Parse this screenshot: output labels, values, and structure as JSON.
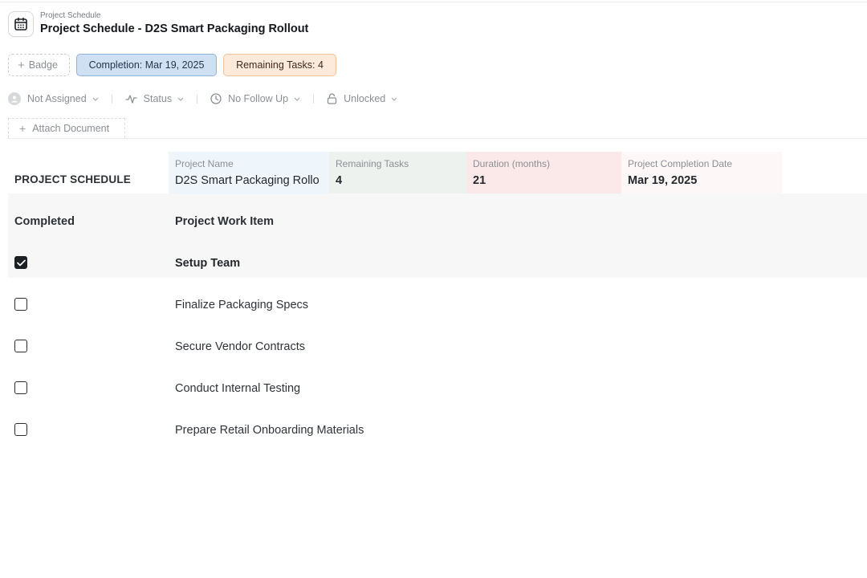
{
  "header": {
    "subtitle": "Project Schedule",
    "title": "Project Schedule - D2S Smart Packaging Rollout",
    "icon": "calendar-icon"
  },
  "badges": {
    "add_label": "Badge",
    "completion": "Completion: Mar 19, 2025",
    "remaining": "Remaining Tasks: 4"
  },
  "meta": {
    "assignee": "Not Assigned",
    "status": "Status",
    "follow_up": "No Follow Up",
    "lock": "Unlocked"
  },
  "attach_label": "Attach Document",
  "summary": {
    "label": "PROJECT SCHEDULE",
    "project_name_key": "Project Name",
    "project_name_value": "D2S Smart Packaging Rollo",
    "remaining_key": "Remaining Tasks",
    "remaining_value": "4",
    "duration_key": "Duration (months)",
    "duration_value": "21",
    "completion_key": "Project Completion Date",
    "completion_value": "Mar 19, 2025"
  },
  "table": {
    "col_completed": "Completed",
    "col_item": "Project Work Item",
    "rows": [
      {
        "item": "Setup Team",
        "completed": true
      },
      {
        "item": "Finalize Packaging Specs",
        "completed": false
      },
      {
        "item": "Secure Vendor Contracts",
        "completed": false
      },
      {
        "item": "Conduct Internal Testing",
        "completed": false
      },
      {
        "item": "Prepare Retail Onboarding Materials",
        "completed": false
      }
    ]
  },
  "colors": {
    "completion_badge": "#cfe0f3",
    "remaining_badge": "#fdeadb",
    "project_name_cell": "#eef6fb",
    "remaining_cell": "#eef2ee",
    "duration_cell": "#fbe9e9",
    "completion_cell": "#fdf8f7"
  }
}
